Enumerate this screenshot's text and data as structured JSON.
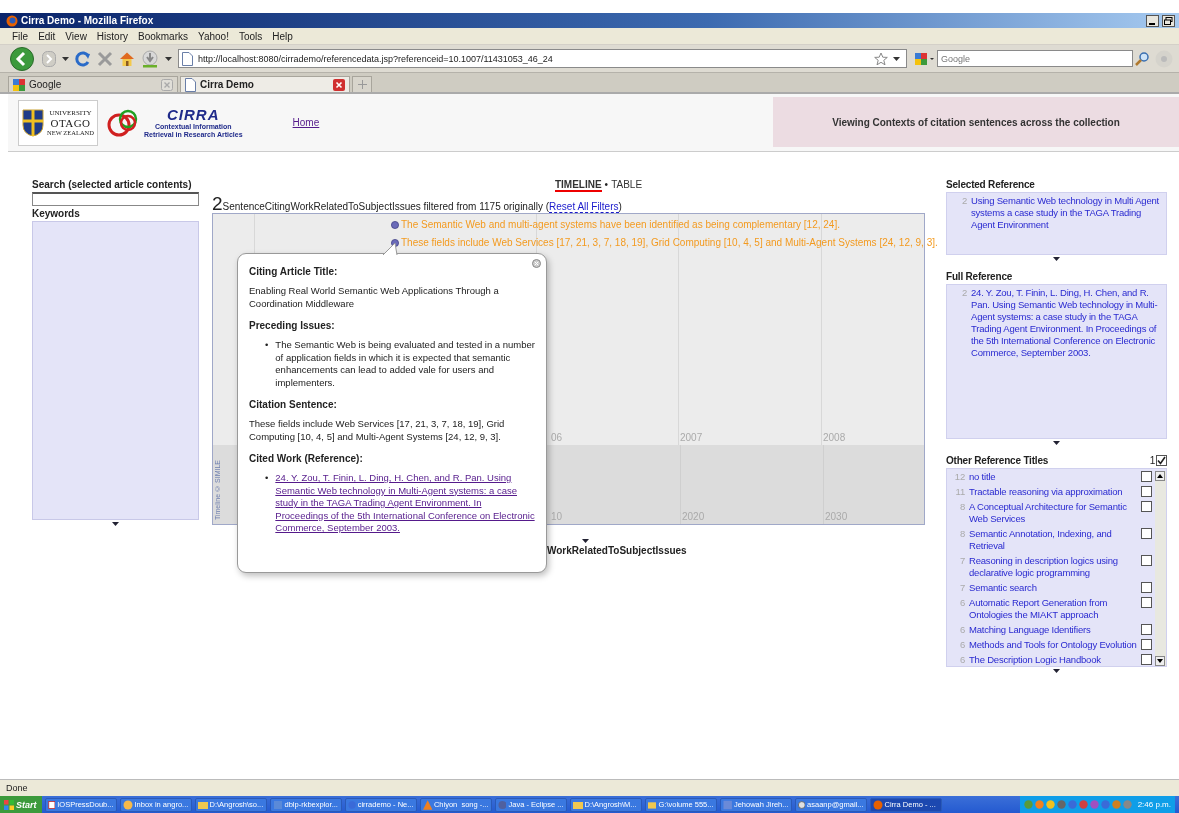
{
  "window": {
    "title": "Cirra Demo - Mozilla Firefox"
  },
  "menu": [
    "File",
    "Edit",
    "View",
    "History",
    "Bookmarks",
    "Yahoo!",
    "Tools",
    "Help"
  ],
  "navigation": {
    "url": "http://localhost:8080/cirrademo/referencedata.jsp?referenceid=10.1007/11431053_46_24",
    "search_placeholder": "Google"
  },
  "tabs": [
    {
      "label": "Google",
      "selected": false
    },
    {
      "label": "Cirra Demo",
      "selected": true
    }
  ],
  "header": {
    "university_logo": {
      "line_1": "UNIVERSITY",
      "line_2": "OTAGO",
      "line_3": "NEW ZEALAND"
    },
    "cirra_logo": {
      "name": "CIRRA",
      "line_1": "Contextual Information",
      "line_2": "Retrieval in Research Articles"
    },
    "home_link": "Home",
    "banner": "Viewing Contexts of citation sentences across the collection"
  },
  "left_panel": {
    "search_label": "Search (selected article contents)",
    "keywords_label": "Keywords"
  },
  "view_switch": {
    "options": [
      {
        "label": "TIMELINE",
        "selected": true
      },
      {
        "label": "TABLE",
        "selected": false
      }
    ],
    "separator": "•"
  },
  "summary": {
    "count": "2",
    "before": "SentenceCitingWorkRelatedToSubjectIssues filtered from 1175 originally (",
    "link": "Reset All Filters",
    "after": ")"
  },
  "timeline": {
    "events": [
      {
        "text": "The Semantic Web and multi-agent systems have been identified as being complementary [12, 24]."
      },
      {
        "text": "These fields include Web Services [17, 21, 3, 7, 18, 19], Grid Computing [10, 4, 5] and Multi-Agent Systems [24, 12, 9, 3]."
      }
    ],
    "upper_ticks": [
      "06",
      "2007",
      "2008"
    ],
    "lower_ticks": [
      "10",
      "2020",
      "2030"
    ],
    "credit": "Timeline © SIMILE",
    "caption": "WorkRelatedToSubjectIssues"
  },
  "popup": {
    "sections": [
      {
        "heading": "Citing Article Title:",
        "kind": "paragraph",
        "text": "Enabling Real World Semantic Web Applications Through a Coordination Middleware"
      },
      {
        "heading": "Preceding Issues:",
        "kind": "bullets",
        "bullet": "•",
        "items": [
          "The Semantic Web is being evaluated and tested in a number of application fields in which it is expected that semantic enhancements can lead to added vale for users and implementers."
        ]
      },
      {
        "heading": "Citation Sentence:",
        "kind": "paragraph",
        "text": "These fields include Web Services [17, 21, 3, 7, 18, 19], Grid Computing [10, 4, 5] and Multi-Agent Systems [24, 12, 9, 3]."
      },
      {
        "heading": "Cited Work (Reference):",
        "kind": "links",
        "bullet": "•",
        "items": [
          "24. Y. Zou, T. Finin, L. Ding, H. Chen, and R. Pan. Using Semantic Web technology in Multi-Agent systems: a case study in the TAGA Trading Agent Environment. In Proceedings of the 5th International Conference on Electronic Commerce, September 2003."
        ]
      }
    ]
  },
  "right_panel": {
    "selected_reference": {
      "heading": "Selected Reference",
      "count": "2",
      "text": "Using Semantic Web technology in Multi Agent systems a case study in the TAGA Trading Agent Environment"
    },
    "full_reference": {
      "heading": "Full Reference",
      "count": "2",
      "text": "24. Y. Zou, T. Finin, L. Ding, H. Chen, and R. Pan. Using Semantic Web technology in Multi-Agent systems: a case study in the TAGA Trading Agent Environment. In Proceedings of the 5th International Conference on Electronic Commerce, September 2003."
    },
    "other_titles": {
      "heading": "Other Reference Titles",
      "selected_count": "1",
      "all_checked": true,
      "items": [
        {
          "count": "12",
          "title": "no title",
          "checked": false
        },
        {
          "count": "11",
          "title": "Tractable reasoning via approximation",
          "checked": false
        },
        {
          "count": "8",
          "title": "A Conceptual Architecture for Semantic Web Services",
          "checked": false
        },
        {
          "count": "8",
          "title": "Semantic Annotation, Indexing, and Retrieval",
          "checked": false
        },
        {
          "count": "7",
          "title": "Reasoning in description logics using declarative logic programming",
          "checked": false
        },
        {
          "count": "7",
          "title": "Semantic search",
          "checked": false
        },
        {
          "count": "6",
          "title": "Automatic Report Generation from Ontologies the MIAKT approach",
          "checked": false
        },
        {
          "count": "6",
          "title": "Matching Language Identifiers",
          "checked": false
        },
        {
          "count": "6",
          "title": "Methods and Tools for Ontology Evolution",
          "checked": false
        },
        {
          "count": "6",
          "title": "The Description Logic Handbook",
          "checked": false
        }
      ]
    }
  },
  "status_bar": "Done",
  "taskbar": {
    "start": "Start",
    "items": [
      {
        "label": "IOSPressDoub...",
        "selected": false
      },
      {
        "label": "Inbox in angro...",
        "selected": false
      },
      {
        "label": "D:\\Angrosh\\so...",
        "selected": false
      },
      {
        "label": "dblp-rkbexplor...",
        "selected": false
      },
      {
        "label": "cirrademo - Ne...",
        "selected": false
      },
      {
        "label": "Chiyon  song -...",
        "selected": false
      },
      {
        "label": "Java - Eclipse ...",
        "selected": false
      },
      {
        "label": "D:\\Angrosh\\M...",
        "selected": false
      },
      {
        "label": "G:\\volume 555...",
        "selected": false
      },
      {
        "label": "Jehowah Jireh...",
        "selected": false
      },
      {
        "label": "asaanp@gmail...",
        "selected": false
      },
      {
        "label": "Cirra Demo - ...",
        "selected": true
      }
    ],
    "clock": "2:46 p.m."
  }
}
